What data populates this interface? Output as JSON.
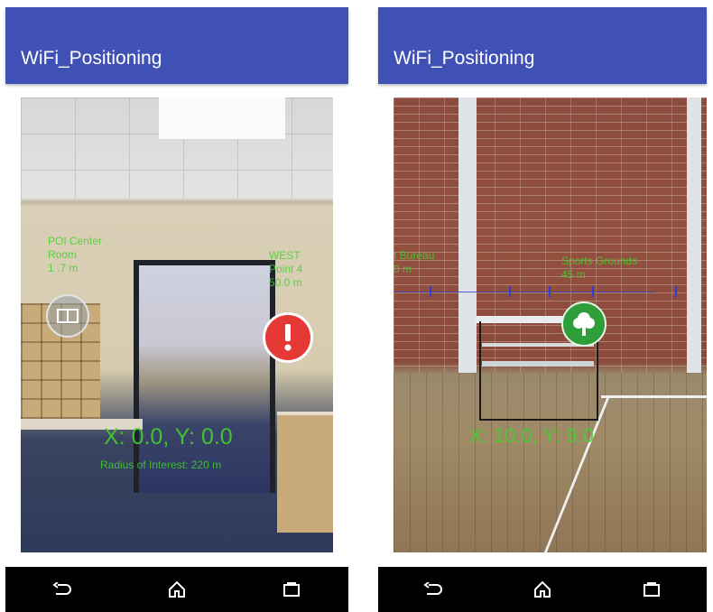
{
  "left_phone": {
    "app_title": "WiFi_Positioning",
    "poi_left_label_lines": [
      "POI Center",
      "Room",
      "1 .7 m"
    ],
    "poi_right_label_lines": [
      "WEST",
      "Point 4",
      "50.0 m"
    ],
    "coordinates": "X: 0.0, Y: 0.0",
    "radius": "Radius of Interest: 220 m"
  },
  "right_phone": {
    "app_title": "WiFi_Positioning",
    "poi_left_label_lines": [
      "t Bureau",
      "0 m"
    ],
    "poi_right_label_lines": [
      "Sports Grounds",
      "45 m"
    ],
    "coordinates": "X: 10.0, Y: 9.0"
  },
  "navbar": {
    "icons": [
      "back-icon",
      "home-icon",
      "recents-icon"
    ]
  },
  "colors": {
    "appbar": "#3f51b5",
    "ar_text": "#43d02e",
    "alert": "#e53935",
    "tree_poi": "#2e9e3a"
  }
}
